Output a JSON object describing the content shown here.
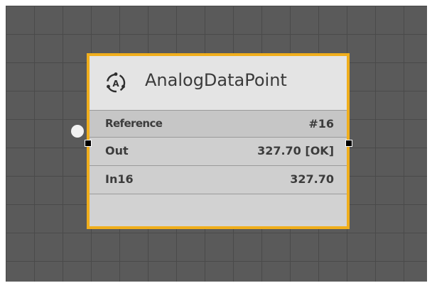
{
  "node": {
    "title": "AnalogDataPoint",
    "icon": "analog-cycle-a-icon",
    "icon_letter": "A",
    "accent_color": "#f0ae1c",
    "rows": [
      {
        "label": "Reference",
        "value": "#16"
      },
      {
        "label": "Out",
        "value": "327.70 [OK]"
      },
      {
        "label": "In16",
        "value": "327.70"
      }
    ]
  }
}
